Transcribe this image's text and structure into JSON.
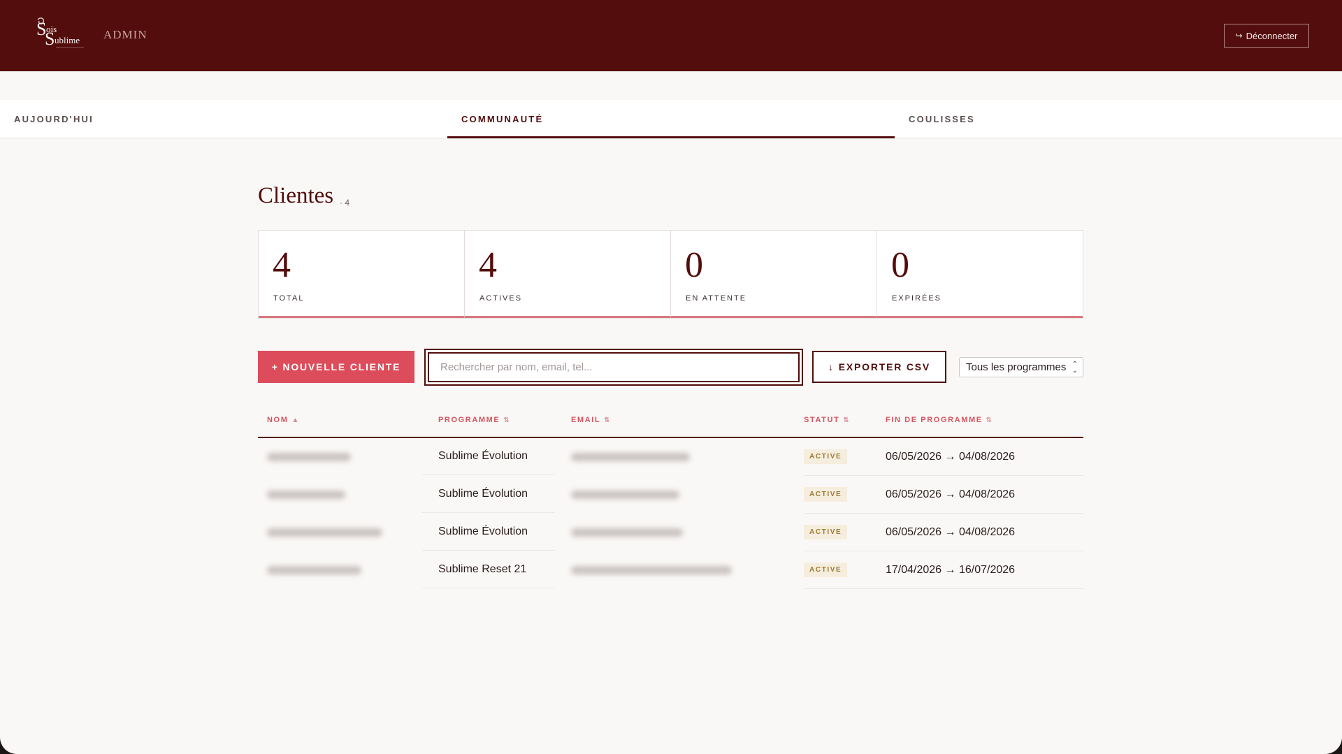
{
  "header": {
    "logo_text": "Sois Sublime",
    "admin_label": "ADMIN",
    "logout_label": "Déconnecter"
  },
  "tabs": [
    {
      "label": "AUJOURD'HUI",
      "active": false
    },
    {
      "label": "COMMUNAUTÉ",
      "active": true
    },
    {
      "label": "COULISSES",
      "active": false
    }
  ],
  "page": {
    "title": "Clientes",
    "count": "· 4"
  },
  "stats": [
    {
      "value": "4",
      "label": "TOTAL"
    },
    {
      "value": "4",
      "label": "ACTIVES"
    },
    {
      "value": "0",
      "label": "EN ATTENTE"
    },
    {
      "value": "0",
      "label": "EXPIRÉES"
    }
  ],
  "toolbar": {
    "new_client_label": "+ NOUVELLE CLIENTE",
    "search_placeholder": "Rechercher par nom, email, tel...",
    "search_value": "",
    "export_label": "EXPORTER CSV",
    "export_icon": "↓",
    "program_filter_value": "Tous les programmes"
  },
  "table": {
    "columns": [
      {
        "label": "NOM",
        "sort": "▲"
      },
      {
        "label": "PROGRAMME",
        "sort": "⇅"
      },
      {
        "label": "EMAIL",
        "sort": "⇅"
      },
      {
        "label": "STATUT",
        "sort": "⇅"
      },
      {
        "label": "FIN DE PROGRAMME",
        "sort": "⇅"
      }
    ],
    "rows": [
      {
        "programme": "Sublime Évolution",
        "statut": "ACTIVE",
        "fin": "06/05/2026 → 04/08/2026"
      },
      {
        "programme": "Sublime Évolution",
        "statut": "ACTIVE",
        "fin": "06/05/2026 → 04/08/2026"
      },
      {
        "programme": "Sublime Évolution",
        "statut": "ACTIVE",
        "fin": "06/05/2026 → 04/08/2026"
      },
      {
        "programme": "Sublime Reset 21",
        "statut": "ACTIVE",
        "fin": "17/04/2026 → 16/07/2026"
      }
    ]
  },
  "colors": {
    "brand_dark": "#520d0c",
    "accent": "#dc4c5a",
    "badge_bg": "#f5eddd",
    "badge_text": "#9c7a33"
  },
  "icons": {
    "logout": "logout-arrow-icon",
    "export": "download-arrow-icon",
    "select": "updown-chevron-icon"
  }
}
